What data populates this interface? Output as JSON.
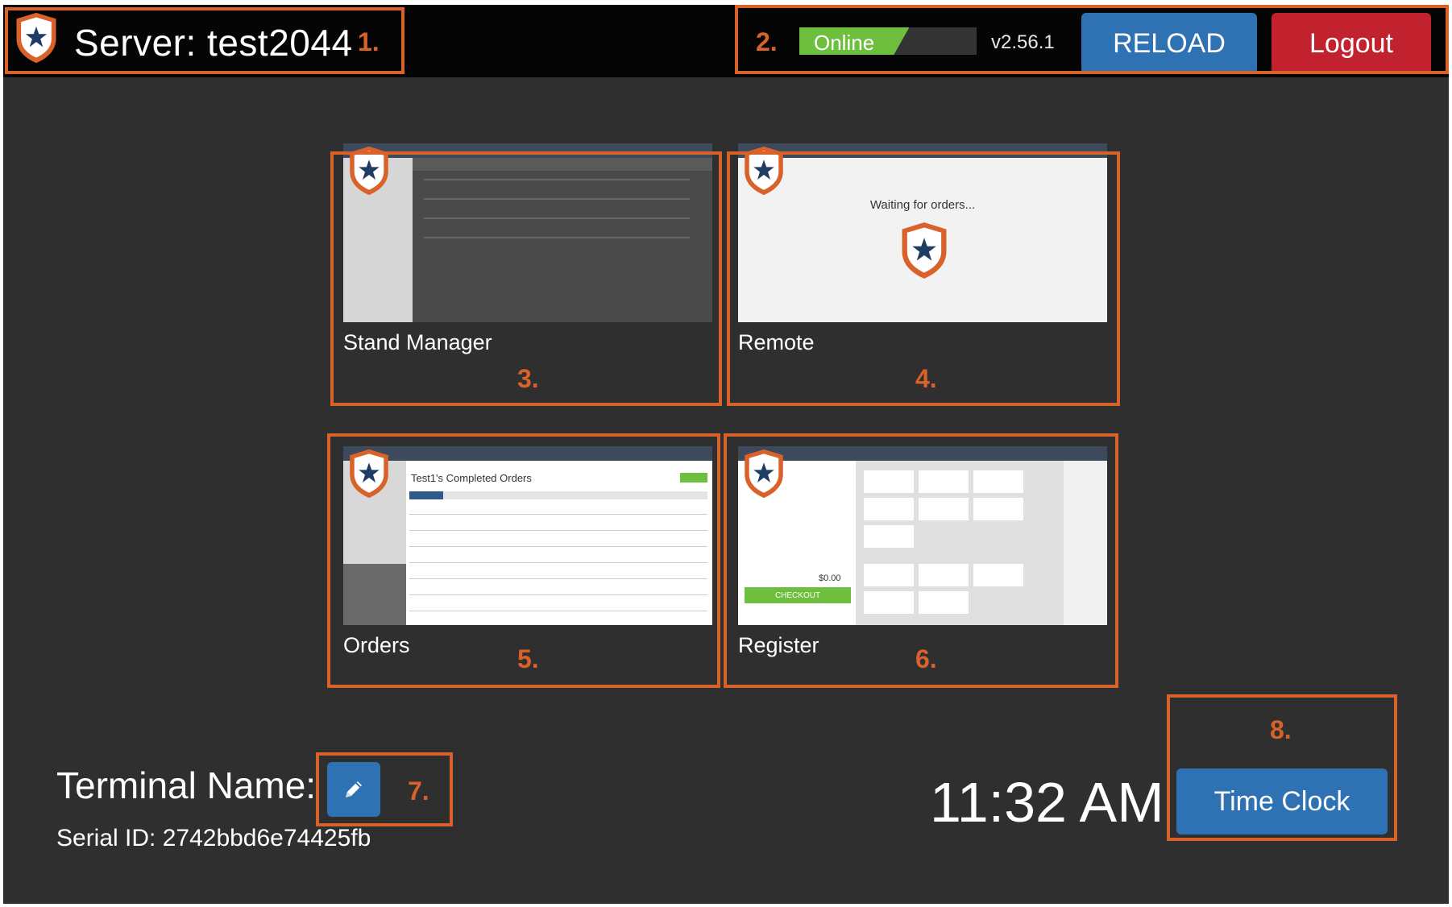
{
  "header": {
    "server_title": "Server: test2044",
    "status_label": "Online",
    "status_level": 0.62,
    "version": "v2.56.1",
    "reload_label": "RELOAD",
    "logout_label": "Logout"
  },
  "apps": [
    {
      "label": "Stand Manager"
    },
    {
      "label": "Remote",
      "waiting_text": "Waiting for orders..."
    },
    {
      "label": "Orders",
      "completed_title": "Test1's Completed Orders"
    },
    {
      "label": "Register",
      "checkout_label": "CHECKOUT",
      "total_value": "$0.00"
    }
  ],
  "footer": {
    "terminal_label": "Terminal Name:",
    "serial_label": "Serial ID: 2742bbd6e74425fb",
    "time": "11:32 AM",
    "time_clock_label": "Time Clock"
  },
  "callouts": [
    "1.",
    "2.",
    "3.",
    "4.",
    "5.",
    "6.",
    "7.",
    "8."
  ],
  "colors": {
    "accent_blue": "#2e72b4",
    "logout_red": "#c2222d",
    "online_green": "#6fbf3f",
    "callout_orange": "#d9622b",
    "background": "#2f2f2f"
  },
  "icons": {
    "logo": "shield-star-icon",
    "edit": "pencil-icon"
  }
}
